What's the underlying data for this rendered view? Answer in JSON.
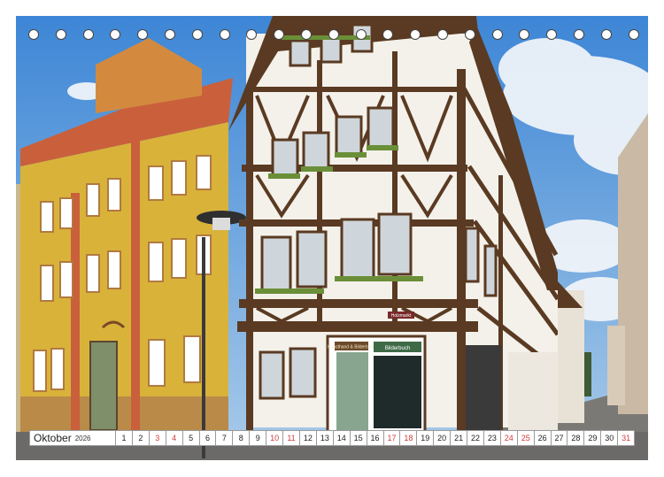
{
  "calendar": {
    "month": "Oktober",
    "year": "2026",
    "days": [
      {
        "n": "1",
        "red": false
      },
      {
        "n": "2",
        "red": false
      },
      {
        "n": "3",
        "red": true
      },
      {
        "n": "4",
        "red": true
      },
      {
        "n": "5",
        "red": false
      },
      {
        "n": "6",
        "red": false
      },
      {
        "n": "7",
        "red": false
      },
      {
        "n": "8",
        "red": false
      },
      {
        "n": "9",
        "red": false
      },
      {
        "n": "10",
        "red": true
      },
      {
        "n": "11",
        "red": true
      },
      {
        "n": "12",
        "red": false
      },
      {
        "n": "13",
        "red": false
      },
      {
        "n": "14",
        "red": false
      },
      {
        "n": "15",
        "red": false
      },
      {
        "n": "16",
        "red": false
      },
      {
        "n": "17",
        "red": true
      },
      {
        "n": "18",
        "red": true
      },
      {
        "n": "19",
        "red": false
      },
      {
        "n": "20",
        "red": false
      },
      {
        "n": "21",
        "red": false
      },
      {
        "n": "22",
        "red": false
      },
      {
        "n": "23",
        "red": false
      },
      {
        "n": "24",
        "red": true
      },
      {
        "n": "25",
        "red": true
      },
      {
        "n": "26",
        "red": false
      },
      {
        "n": "27",
        "red": false
      },
      {
        "n": "28",
        "red": false
      },
      {
        "n": "29",
        "red": false
      },
      {
        "n": "30",
        "red": false
      },
      {
        "n": "31",
        "red": true
      }
    ]
  },
  "photo": {
    "shop_signs": [
      "Kunsthand & Bilderbuch",
      "Bilderbuch"
    ],
    "street_sign": "Holzmarkt"
  },
  "binding": {
    "hole_count": 23
  },
  "colors": {
    "sky": "#6aa6e0",
    "timber": "#5a3a22",
    "plaster": "#f4f1ea",
    "yellow_house": "#d9b23a",
    "weekend": "#d23a3a"
  }
}
